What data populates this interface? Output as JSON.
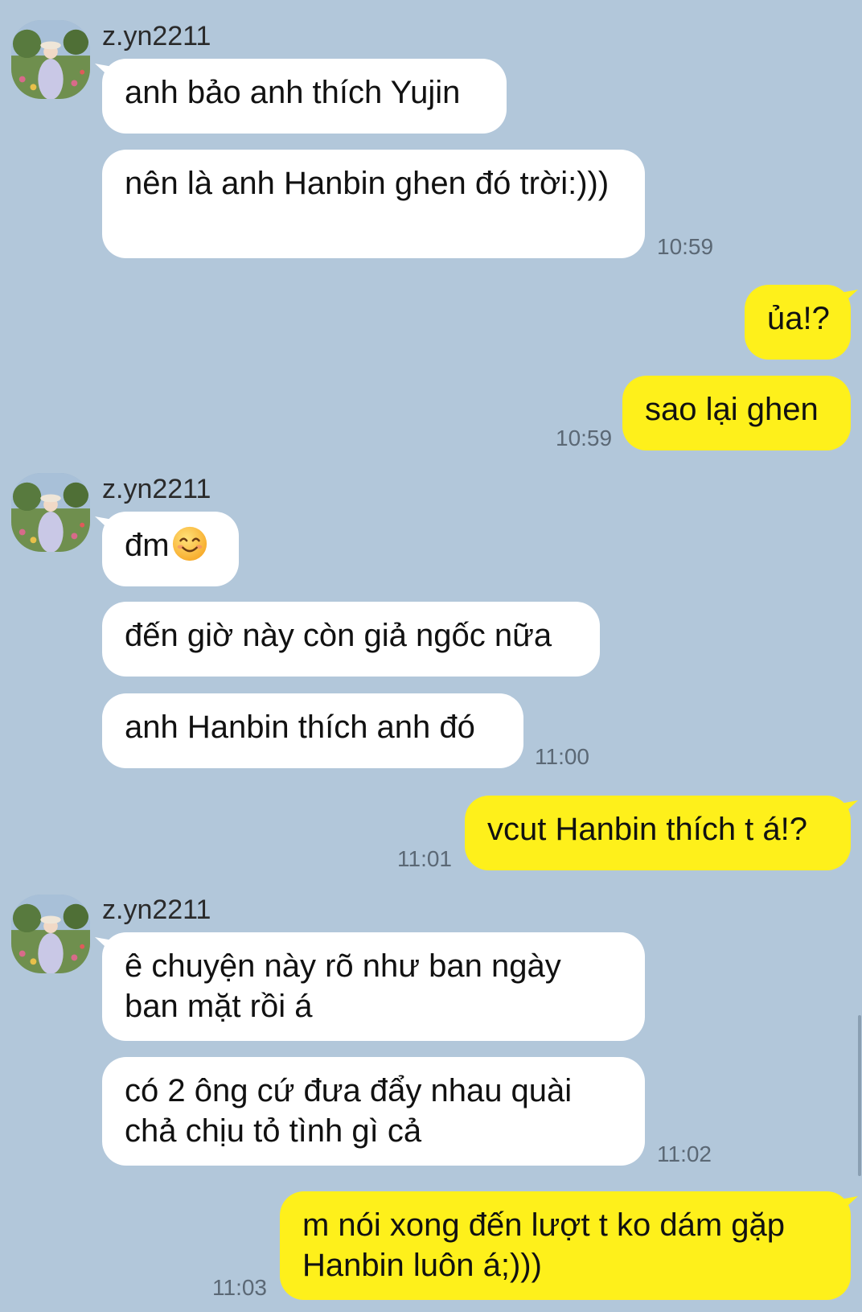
{
  "groups": [
    {
      "sender": "z.yn2211",
      "messages": [
        "anh bảo anh thích Yujin",
        "nên là anh Hanbin ghen đó trời:)))"
      ],
      "time": "10:59"
    },
    {
      "outgoing": true,
      "messages": [
        "ủa!?",
        "sao lại ghen"
      ],
      "time": "10:59"
    },
    {
      "sender": "z.yn2211",
      "messages": [
        "đm",
        "đến giờ này còn giả ngốc nữa",
        "anh Hanbin thích anh đó"
      ],
      "emoji": "smiling-face-emoji",
      "time": "11:00"
    },
    {
      "outgoing": true,
      "messages": [
        "vcut Hanbin thích t á!?"
      ],
      "time": "11:01"
    },
    {
      "sender": "z.yn2211",
      "messages": [
        "ê chuyện này rõ như ban ngày ban mặt rồi á",
        "có 2 ông cứ đưa đẩy nhau quài chả chịu tỏ tình gì cả"
      ],
      "time": "11:02"
    },
    {
      "outgoing": true,
      "messages": [
        "m nói xong đến lượt t ko dám gặp Hanbin luôn á;)))"
      ],
      "time": "11:03"
    }
  ],
  "colors": {
    "background": "#b2c7da",
    "incoming_bubble": "#ffffff",
    "outgoing_bubble": "#fef01b",
    "timestamp": "#5b6875"
  }
}
